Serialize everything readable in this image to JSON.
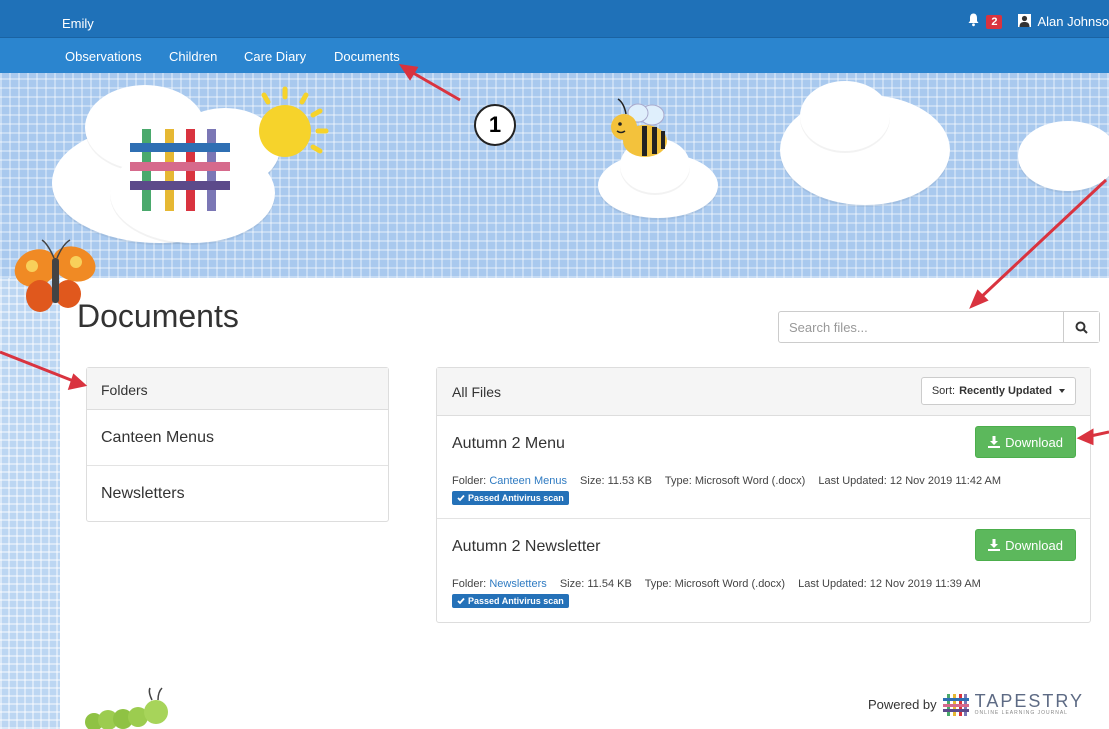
{
  "topbar": {
    "child_name": "Emily",
    "notification_count": "2",
    "user_name": "Alan Johnso"
  },
  "nav": {
    "items": [
      "Observations",
      "Children",
      "Care Diary",
      "Documents"
    ]
  },
  "callout": {
    "number": "1"
  },
  "page": {
    "title": "Documents"
  },
  "search": {
    "placeholder": "Search files..."
  },
  "folders": {
    "heading": "Folders",
    "items": [
      "Canteen Menus",
      "Newsletters"
    ]
  },
  "files": {
    "heading": "All Files",
    "sort_label": "Sort:",
    "sort_value": "Recently Updated",
    "download_label": "Download",
    "folder_label": "Folder:",
    "size_label": "Size:",
    "type_label": "Type:",
    "updated_label": "Last Updated:",
    "av_label": "Passed Antivirus scan",
    "rows": [
      {
        "name": "Autumn 2 Menu",
        "folder": "Canteen Menus",
        "size": "11.53 KB",
        "type": "Microsoft Word (.docx)",
        "updated": "12 Nov 2019 11:42 AM"
      },
      {
        "name": "Autumn 2 Newsletter",
        "folder": "Newsletters",
        "size": "11.54 KB",
        "type": "Microsoft Word (.docx)",
        "updated": "12 Nov 2019 11:39 AM"
      }
    ]
  },
  "footer": {
    "powered_by": "Powered by",
    "brand": "TAPESTRY",
    "brand_sub": "ONLINE LEARNING JOURNAL"
  },
  "colors": {
    "topbar": "#1f71b8",
    "navbar": "#2b85cf",
    "download": "#5cb85c",
    "av_badge": "#2471b8",
    "annotation_arrow": "#d9333f"
  }
}
